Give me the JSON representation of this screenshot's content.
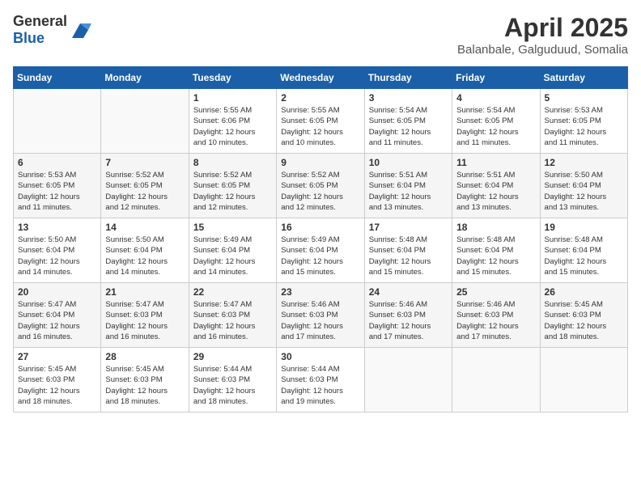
{
  "header": {
    "logo_general": "General",
    "logo_blue": "Blue",
    "month_year": "April 2025",
    "location": "Balanbale, Galguduud, Somalia"
  },
  "weekdays": [
    "Sunday",
    "Monday",
    "Tuesday",
    "Wednesday",
    "Thursday",
    "Friday",
    "Saturday"
  ],
  "weeks": [
    [
      {
        "day": "",
        "info": ""
      },
      {
        "day": "",
        "info": ""
      },
      {
        "day": "1",
        "info": "Sunrise: 5:55 AM\nSunset: 6:06 PM\nDaylight: 12 hours\nand 10 minutes."
      },
      {
        "day": "2",
        "info": "Sunrise: 5:55 AM\nSunset: 6:05 PM\nDaylight: 12 hours\nand 10 minutes."
      },
      {
        "day": "3",
        "info": "Sunrise: 5:54 AM\nSunset: 6:05 PM\nDaylight: 12 hours\nand 11 minutes."
      },
      {
        "day": "4",
        "info": "Sunrise: 5:54 AM\nSunset: 6:05 PM\nDaylight: 12 hours\nand 11 minutes."
      },
      {
        "day": "5",
        "info": "Sunrise: 5:53 AM\nSunset: 6:05 PM\nDaylight: 12 hours\nand 11 minutes."
      }
    ],
    [
      {
        "day": "6",
        "info": "Sunrise: 5:53 AM\nSunset: 6:05 PM\nDaylight: 12 hours\nand 11 minutes."
      },
      {
        "day": "7",
        "info": "Sunrise: 5:52 AM\nSunset: 6:05 PM\nDaylight: 12 hours\nand 12 minutes."
      },
      {
        "day": "8",
        "info": "Sunrise: 5:52 AM\nSunset: 6:05 PM\nDaylight: 12 hours\nand 12 minutes."
      },
      {
        "day": "9",
        "info": "Sunrise: 5:52 AM\nSunset: 6:05 PM\nDaylight: 12 hours\nand 12 minutes."
      },
      {
        "day": "10",
        "info": "Sunrise: 5:51 AM\nSunset: 6:04 PM\nDaylight: 12 hours\nand 13 minutes."
      },
      {
        "day": "11",
        "info": "Sunrise: 5:51 AM\nSunset: 6:04 PM\nDaylight: 12 hours\nand 13 minutes."
      },
      {
        "day": "12",
        "info": "Sunrise: 5:50 AM\nSunset: 6:04 PM\nDaylight: 12 hours\nand 13 minutes."
      }
    ],
    [
      {
        "day": "13",
        "info": "Sunrise: 5:50 AM\nSunset: 6:04 PM\nDaylight: 12 hours\nand 14 minutes."
      },
      {
        "day": "14",
        "info": "Sunrise: 5:50 AM\nSunset: 6:04 PM\nDaylight: 12 hours\nand 14 minutes."
      },
      {
        "day": "15",
        "info": "Sunrise: 5:49 AM\nSunset: 6:04 PM\nDaylight: 12 hours\nand 14 minutes."
      },
      {
        "day": "16",
        "info": "Sunrise: 5:49 AM\nSunset: 6:04 PM\nDaylight: 12 hours\nand 15 minutes."
      },
      {
        "day": "17",
        "info": "Sunrise: 5:48 AM\nSunset: 6:04 PM\nDaylight: 12 hours\nand 15 minutes."
      },
      {
        "day": "18",
        "info": "Sunrise: 5:48 AM\nSunset: 6:04 PM\nDaylight: 12 hours\nand 15 minutes."
      },
      {
        "day": "19",
        "info": "Sunrise: 5:48 AM\nSunset: 6:04 PM\nDaylight: 12 hours\nand 15 minutes."
      }
    ],
    [
      {
        "day": "20",
        "info": "Sunrise: 5:47 AM\nSunset: 6:04 PM\nDaylight: 12 hours\nand 16 minutes."
      },
      {
        "day": "21",
        "info": "Sunrise: 5:47 AM\nSunset: 6:03 PM\nDaylight: 12 hours\nand 16 minutes."
      },
      {
        "day": "22",
        "info": "Sunrise: 5:47 AM\nSunset: 6:03 PM\nDaylight: 12 hours\nand 16 minutes."
      },
      {
        "day": "23",
        "info": "Sunrise: 5:46 AM\nSunset: 6:03 PM\nDaylight: 12 hours\nand 17 minutes."
      },
      {
        "day": "24",
        "info": "Sunrise: 5:46 AM\nSunset: 6:03 PM\nDaylight: 12 hours\nand 17 minutes."
      },
      {
        "day": "25",
        "info": "Sunrise: 5:46 AM\nSunset: 6:03 PM\nDaylight: 12 hours\nand 17 minutes."
      },
      {
        "day": "26",
        "info": "Sunrise: 5:45 AM\nSunset: 6:03 PM\nDaylight: 12 hours\nand 18 minutes."
      }
    ],
    [
      {
        "day": "27",
        "info": "Sunrise: 5:45 AM\nSunset: 6:03 PM\nDaylight: 12 hours\nand 18 minutes."
      },
      {
        "day": "28",
        "info": "Sunrise: 5:45 AM\nSunset: 6:03 PM\nDaylight: 12 hours\nand 18 minutes."
      },
      {
        "day": "29",
        "info": "Sunrise: 5:44 AM\nSunset: 6:03 PM\nDaylight: 12 hours\nand 18 minutes."
      },
      {
        "day": "30",
        "info": "Sunrise: 5:44 AM\nSunset: 6:03 PM\nDaylight: 12 hours\nand 19 minutes."
      },
      {
        "day": "",
        "info": ""
      },
      {
        "day": "",
        "info": ""
      },
      {
        "day": "",
        "info": ""
      }
    ]
  ]
}
